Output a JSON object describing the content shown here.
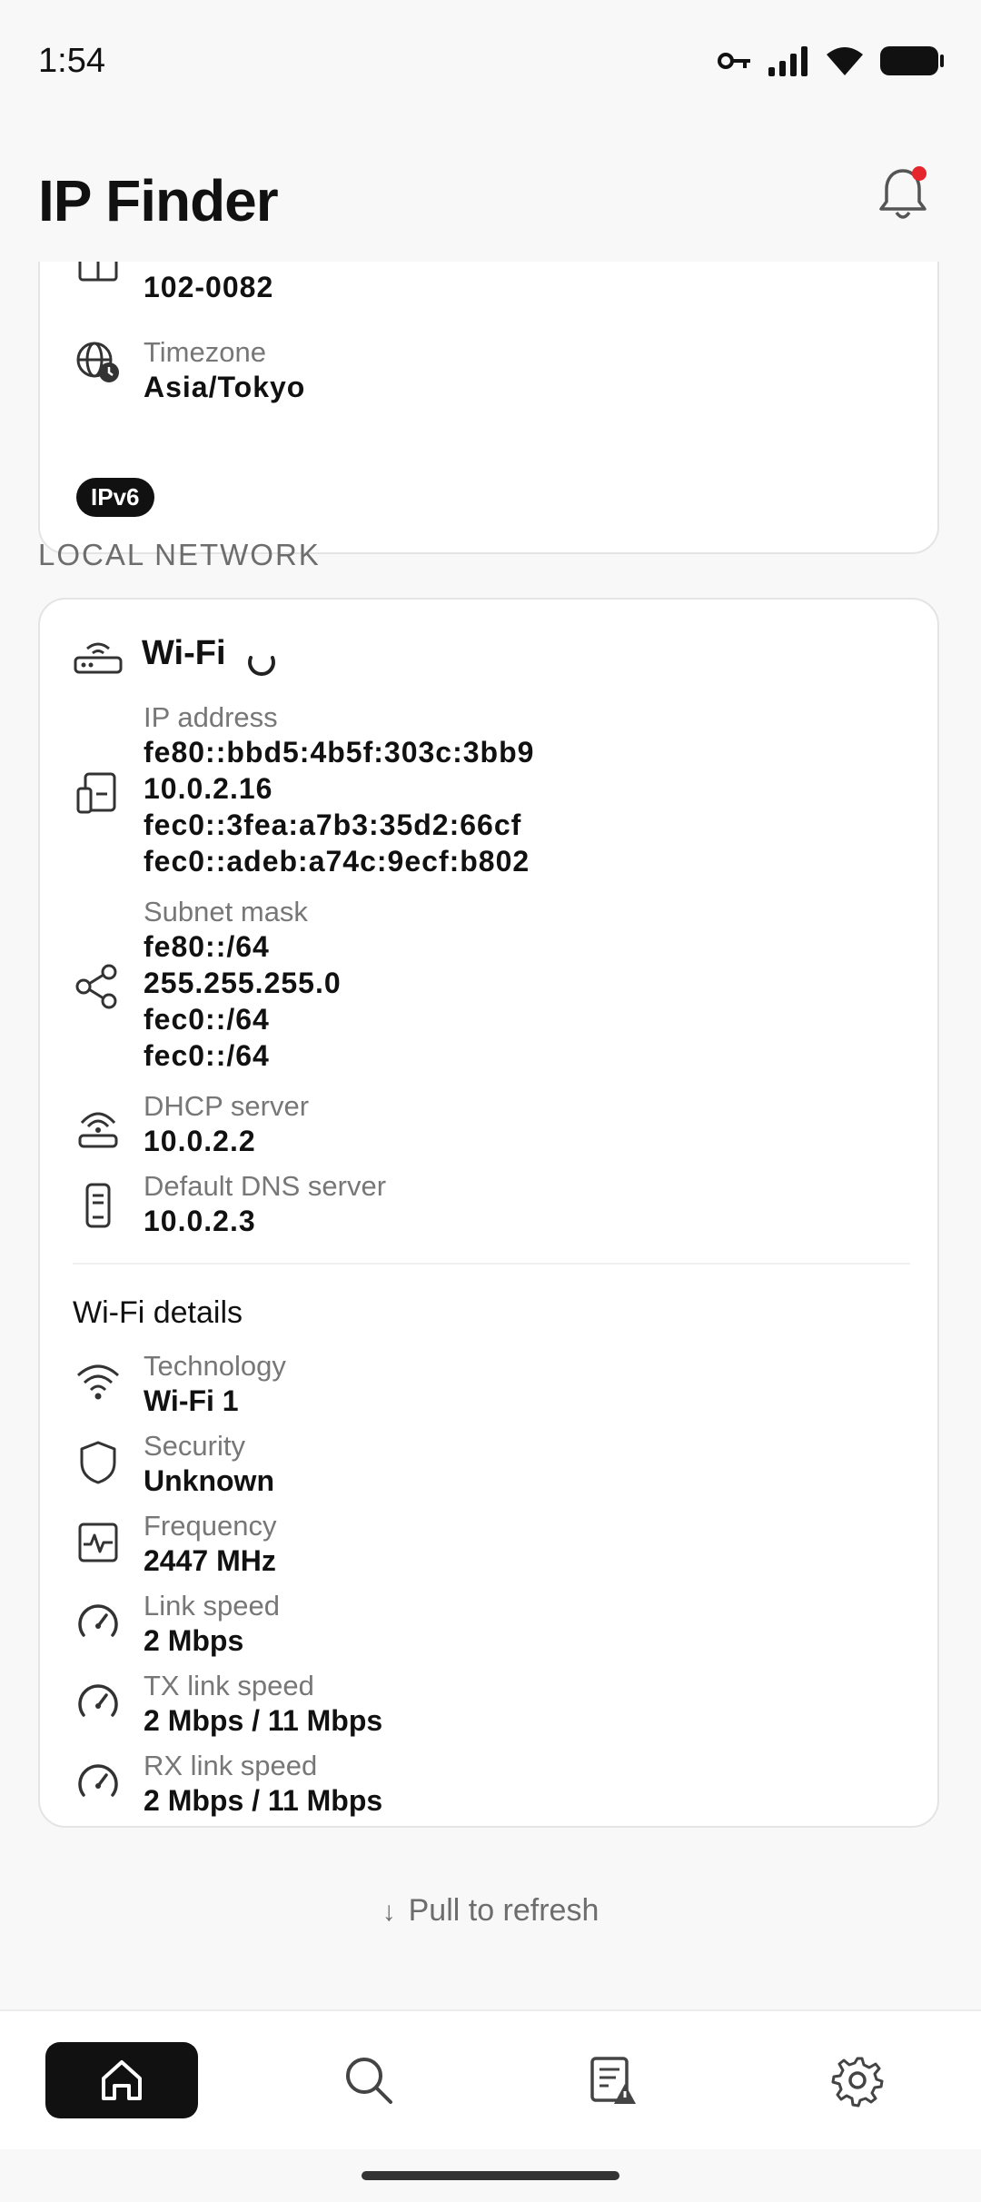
{
  "status_bar": {
    "time": "1:54"
  },
  "header": {
    "title": "IP Finder"
  },
  "public_card": {
    "postal_value": "102-0082",
    "timezone_label": "Timezone",
    "timezone_value": "Asia/Tokyo",
    "badge": "IPv6"
  },
  "section_label": "LOCAL NETWORK",
  "wifi_card": {
    "title": "Wi-Fi",
    "ip_label": "IP address",
    "ip_values": [
      "fe80::bbd5:4b5f:303c:3bb9",
      "10.0.2.16",
      "fec0::3fea:a7b3:35d2:66cf",
      "fec0::adeb:a74c:9ecf:b802"
    ],
    "subnet_label": "Subnet mask",
    "subnet_values": [
      "fe80::/64",
      "255.255.255.0",
      "fec0::/64",
      "fec0::/64"
    ],
    "dhcp_label": "DHCP server",
    "dhcp_value": "10.0.2.2",
    "dns_label": "Default DNS server",
    "dns_value": "10.0.2.3",
    "details_title": "Wi-Fi details",
    "technology_label": "Technology",
    "technology_value": "Wi-Fi 1",
    "security_label": "Security",
    "security_value": "Unknown",
    "frequency_label": "Frequency",
    "frequency_value": "2447 MHz",
    "link_speed_label": "Link speed",
    "link_speed_value": "2 Mbps",
    "tx_label": "TX link speed",
    "tx_value": "2 Mbps / 11 Mbps",
    "rx_label": "RX link speed",
    "rx_value": "2 Mbps / 11 Mbps"
  },
  "refresh_hint": "Pull to refresh",
  "colors": {
    "accent": "#111111",
    "notification_dot": "#e5262c",
    "muted": "#777777"
  },
  "nav": {
    "items": [
      "home-icon",
      "search-icon",
      "report-icon",
      "gear-icon"
    ],
    "active": 0
  }
}
